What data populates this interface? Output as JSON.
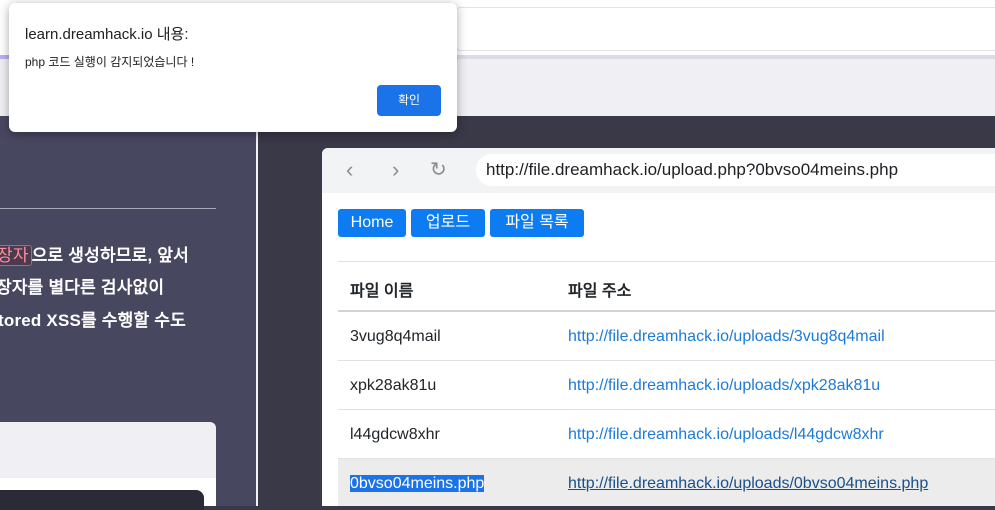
{
  "dialog": {
    "title": "learn.dreamhack.io 내용:",
    "message": "php 코드 실행이 감지되었습니다 !",
    "ok_label": "확인"
  },
  "lesson": {
    "lines": [
      {
        "highlight": "장자",
        "text": "으로 생성하므로, 앞서"
      },
      {
        "highlight": "",
        "text": "장자를 별다른 검사없이"
      },
      {
        "highlight": "",
        "text": "tored XSS를 수행할 수도"
      }
    ]
  },
  "browser": {
    "url": "http://file.dreamhack.io/upload.php?0bvso04meins.php",
    "buttons": {
      "home": "Home",
      "upload": "업로드",
      "list": "파일 목록"
    }
  },
  "table": {
    "headers": {
      "name": "파일 이름",
      "address": "파일 주소"
    },
    "rows": [
      {
        "name": "3vug8q4mail",
        "url": "http://file.dreamhack.io/uploads/3vug8q4mail"
      },
      {
        "name": "xpk28ak81u",
        "url": "http://file.dreamhack.io/uploads/xpk28ak81u"
      },
      {
        "name": "l44gdcw8xhr",
        "url": "http://file.dreamhack.io/uploads/l44gdcw8xhr"
      },
      {
        "name": "0bvso04meins.php",
        "url": "http://file.dreamhack.io/uploads/0bvso04meins.php"
      }
    ]
  },
  "icons": {
    "back": "back-arrow-icon",
    "forward": "forward-arrow-icon",
    "reload": "reload-icon"
  },
  "colors": {
    "primary": "#0d7cf2",
    "link": "#1c7ad8",
    "dialog_button": "#1a73e8",
    "lesson_bg": "#484760"
  }
}
